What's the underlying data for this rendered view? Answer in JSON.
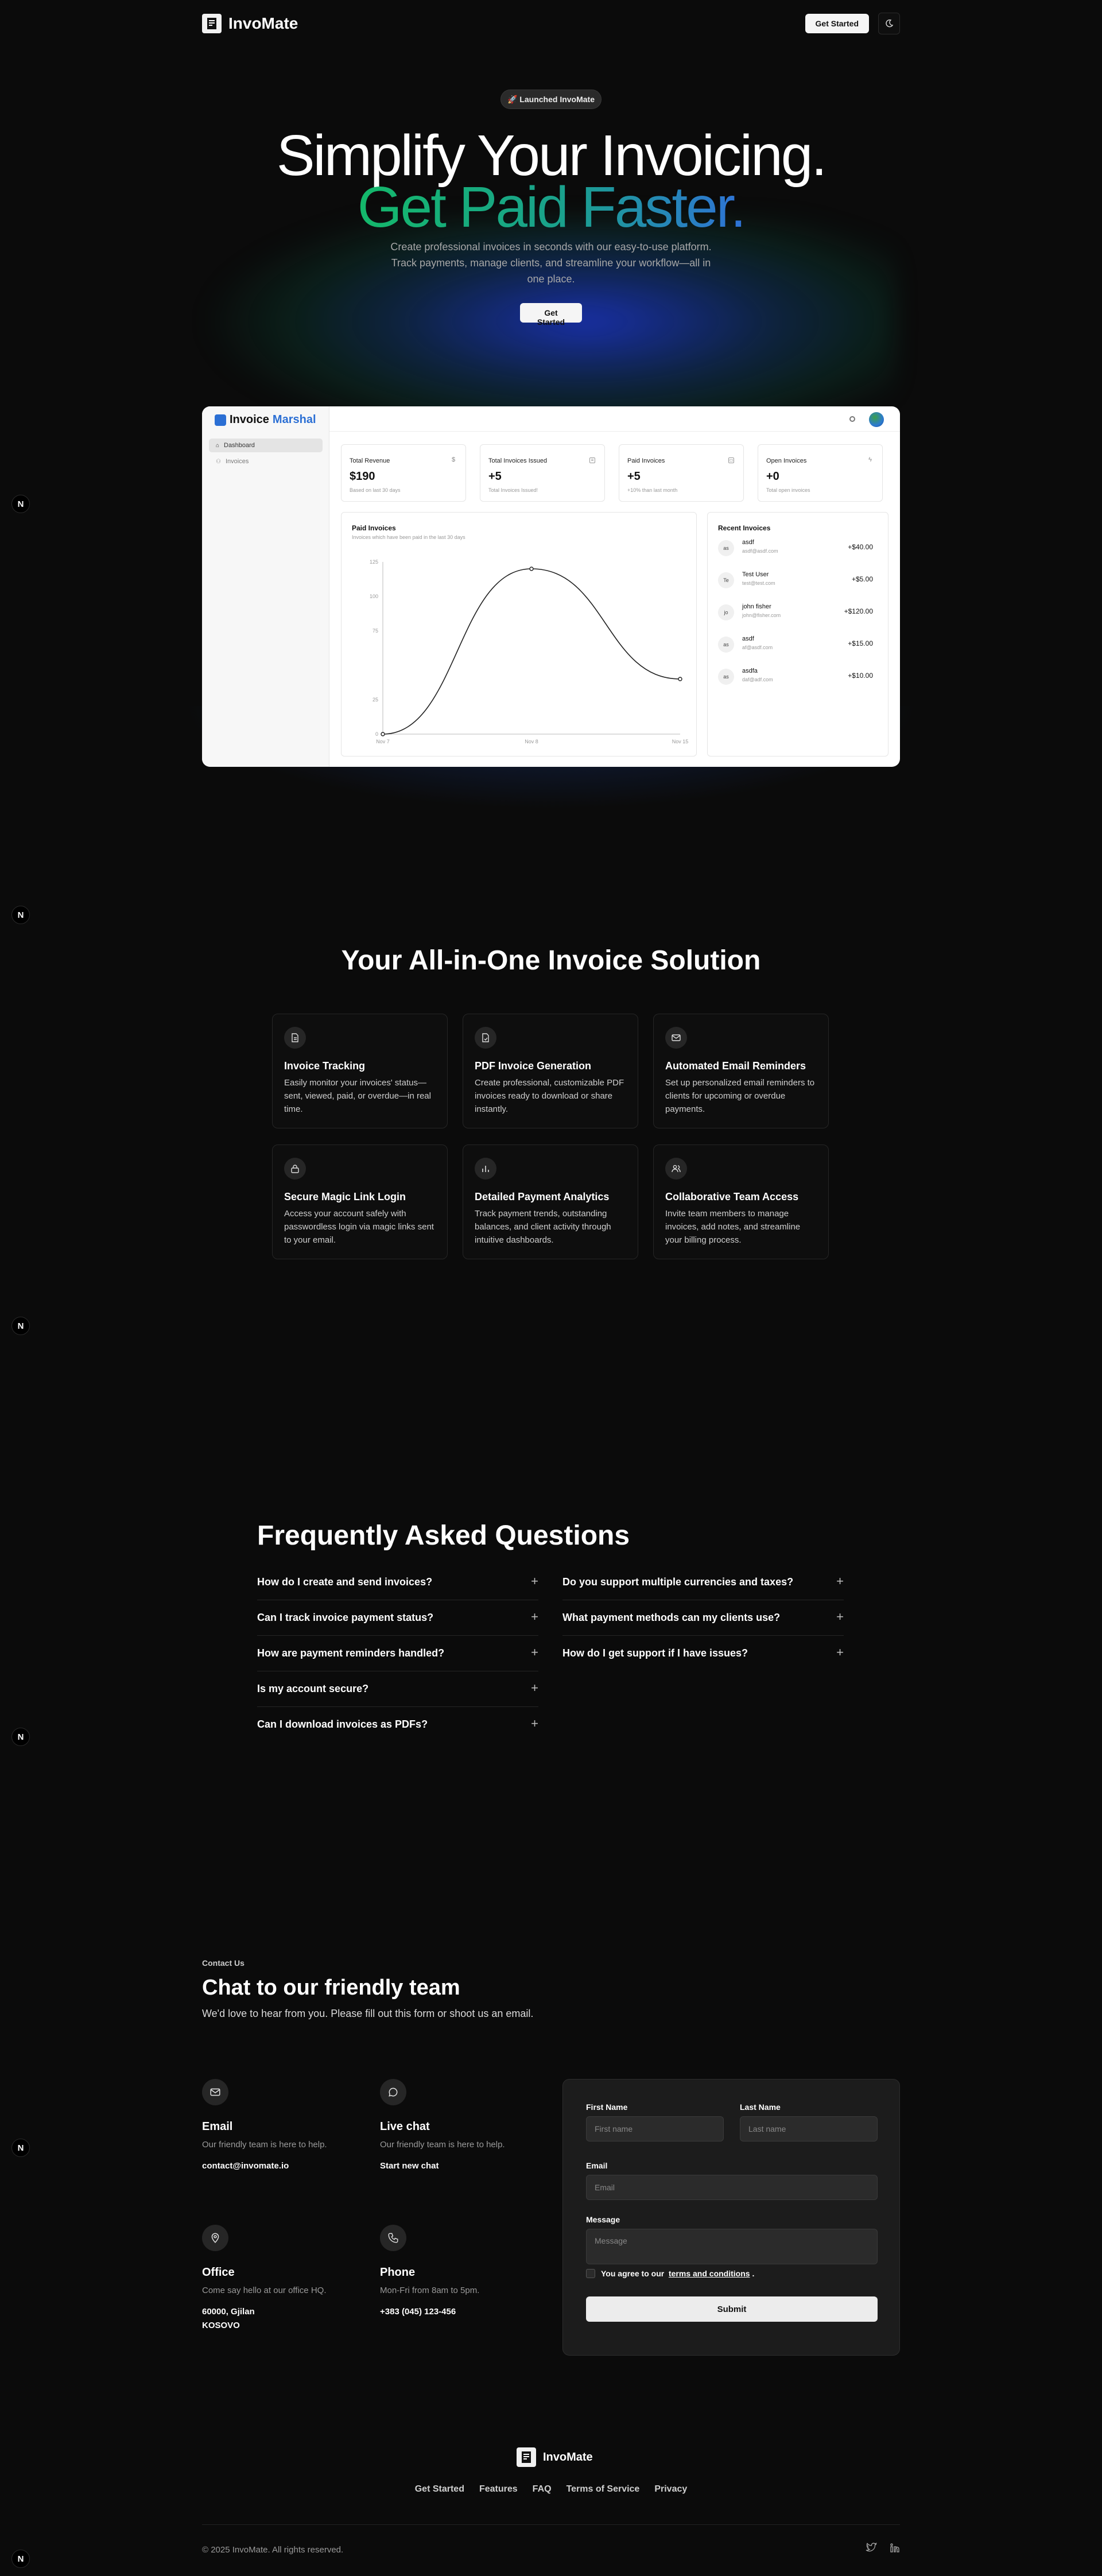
{
  "nav": {
    "brand": "InvoMate",
    "get_started": "Get Started",
    "theme_icon": "moon-icon"
  },
  "side_marker": "N",
  "hero": {
    "pill": "🚀 Launched InvoMate",
    "line1": "Simplify Your Invoicing.",
    "line2": "Get Paid Faster.",
    "subtitle": "Create professional invoices in seconds with our easy-to-use platform. Track payments, manage clients, and streamline your workflow—all in one place.",
    "cta": "Get Started",
    "gradient_colors": [
      "#14b86a",
      "#2f72d8"
    ]
  },
  "dashboard": {
    "brand_a": "Invoice",
    "brand_b": "Marshal",
    "nav": [
      {
        "label": "Dashboard",
        "icon": "home-icon",
        "active": true
      },
      {
        "label": "Invoices",
        "icon": "users-icon",
        "active": false
      }
    ],
    "kpis": [
      {
        "title": "Total Revenue",
        "value": "$190",
        "sub": "Based on last 30 days",
        "icon": "$"
      },
      {
        "title": "Total Invoices Issued",
        "value": "+5",
        "sub": "Total Invoices Issued!",
        "icon": "≡"
      },
      {
        "title": "Paid Invoices",
        "value": "+5",
        "sub": "+10% than last month",
        "icon": "▭"
      },
      {
        "title": "Open Invoices",
        "value": "+0",
        "sub": "Total open invoices",
        "icon": "ϟ"
      }
    ],
    "paid_invoices": {
      "title": "Paid Invoices",
      "subtitle": "Invoices which have been paid in the last 30 days"
    },
    "recent": {
      "title": "Recent Invoices",
      "rows": [
        {
          "initials": "as",
          "name": "asdf",
          "email": "asdf@asdf.com",
          "amount": "+$40.00"
        },
        {
          "initials": "Te",
          "name": "Test User",
          "email": "test@test.com",
          "amount": "+$5.00"
        },
        {
          "initials": "jo",
          "name": "john fisher",
          "email": "john@fisher.com",
          "amount": "+$120.00"
        },
        {
          "initials": "as",
          "name": "asdf",
          "email": "af@asdf.com",
          "amount": "+$15.00"
        },
        {
          "initials": "as",
          "name": "asdfa",
          "email": "daf@adf.com",
          "amount": "+$10.00"
        }
      ]
    }
  },
  "chart_data": {
    "type": "line",
    "x": [
      "Nov 7",
      "Nov 8",
      "Nov 15"
    ],
    "y": [
      0,
      120,
      40
    ],
    "ylim": [
      0,
      125
    ],
    "yticks": [
      "0",
      "25",
      "75",
      "100",
      "125"
    ],
    "title": "Paid Invoices",
    "xlabel": "",
    "ylabel": "",
    "grid": false
  },
  "features": {
    "title": "Your All-in-One Invoice Solution",
    "items": [
      {
        "title": "Invoice Tracking",
        "desc": "Easily monitor your invoices' status—sent, viewed, paid, or overdue—in real time.",
        "icon": "file-icon"
      },
      {
        "title": "PDF Invoice Generation",
        "desc": "Create professional, customizable PDF invoices ready to download or share instantly.",
        "icon": "pdf-file-icon"
      },
      {
        "title": "Automated Email Reminders",
        "desc": "Set up personalized email reminders to clients for upcoming or overdue payments.",
        "icon": "mail-icon"
      },
      {
        "title": "Secure Magic Link Login",
        "desc": "Access your account safely with passwordless login via magic links sent to your email.",
        "icon": "lock-icon"
      },
      {
        "title": "Detailed Payment Analytics",
        "desc": "Track payment trends, outstanding balances, and client activity through intuitive dashboards.",
        "icon": "bar-chart-icon"
      },
      {
        "title": "Collaborative Team Access",
        "desc": "Invite team members to manage invoices, add notes, and streamline your billing process.",
        "icon": "team-icon"
      }
    ]
  },
  "faq": {
    "title": "Frequently Asked Questions",
    "left": [
      "How do I create and send invoices?",
      "Can I track invoice payment status?",
      "How are payment reminders handled?",
      "Is my account secure?",
      "Can I download invoices as PDFs?"
    ],
    "right": [
      "Do you support multiple currencies and taxes?",
      "What payment methods can my clients use?",
      "How do I get support if I have issues?"
    ],
    "plus": "+"
  },
  "contact": {
    "eyebrow": "Contact Us",
    "title": "Chat to our friendly team",
    "subtitle": "We'd love to hear from you. Please fill out this form or shoot us an email.",
    "blocks": [
      {
        "title": "Email",
        "desc": "Our friendly team is here to help.",
        "value": "contact@invomate.io",
        "icon": "mail-icon"
      },
      {
        "title": "Live chat",
        "desc": "Our friendly team is here to help.",
        "value": "Start new chat",
        "icon": "chat-icon"
      },
      {
        "title": "Office",
        "desc": "Come say hello at our office HQ.",
        "value": "60000, Gjilan\nKOSOVO",
        "icon": "map-pin-icon"
      },
      {
        "title": "Phone",
        "desc": "Mon-Fri from 8am to 5pm.",
        "value": "+383 (045) 123-456",
        "icon": "phone-icon"
      }
    ],
    "form": {
      "first_name_label": "First Name",
      "first_name_placeholder": "First name",
      "last_name_label": "Last Name",
      "last_name_placeholder": "Last name",
      "email_label": "Email",
      "email_placeholder": "Email",
      "message_label": "Message",
      "message_placeholder": "Message",
      "agree_prefix": "You agree to our",
      "agree_link": "terms and conditions",
      "agree_suffix": ".",
      "submit": "Submit"
    }
  },
  "footer": {
    "brand": "InvoMate",
    "links": [
      "Get Started",
      "Features",
      "FAQ",
      "Terms of Service",
      "Privacy"
    ],
    "copyright": "© 2025 InvoMate. All rights reserved."
  }
}
